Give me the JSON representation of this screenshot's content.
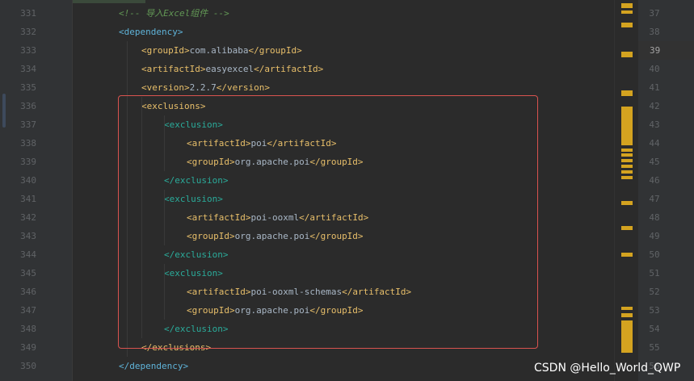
{
  "gutter_left": {
    "line_numbers": [
      "331",
      "332",
      "333",
      "334",
      "335",
      "336",
      "337",
      "338",
      "339",
      "340",
      "341",
      "342",
      "343",
      "344",
      "345",
      "346",
      "347",
      "348",
      "349",
      "350"
    ]
  },
  "code": {
    "comment": "<!-- 导入Excel组件 -->",
    "lines": [
      {
        "open": "<dependency>",
        "text": "",
        "close": ""
      },
      {
        "open": "<groupId>",
        "text": "com.alibaba",
        "close": "</groupId>"
      },
      {
        "open": "<artifactId>",
        "text": "easyexcel",
        "close": "</artifactId>"
      },
      {
        "open": "<version>",
        "text": "2.2.7",
        "close": "</version>"
      },
      {
        "open": "<exclusions>",
        "text": "",
        "close": ""
      },
      {
        "open": "<exclusion>",
        "text": "",
        "close": ""
      },
      {
        "open": "<artifactId>",
        "text": "poi",
        "close": "</artifactId>"
      },
      {
        "open": "<groupId>",
        "text": "org.apache.poi",
        "close": "</groupId>"
      },
      {
        "open": "",
        "text": "",
        "close": "</exclusion>"
      },
      {
        "open": "<exclusion>",
        "text": "",
        "close": ""
      },
      {
        "open": "<artifactId>",
        "text": "poi-ooxml",
        "close": "</artifactId>"
      },
      {
        "open": "<groupId>",
        "text": "org.apache.poi",
        "close": "</groupId>"
      },
      {
        "open": "",
        "text": "",
        "close": "</exclusion>"
      },
      {
        "open": "<exclusion>",
        "text": "",
        "close": ""
      },
      {
        "open": "<artifactId>",
        "text": "poi-ooxml-schemas",
        "close": "</artifactId>"
      },
      {
        "open": "<groupId>",
        "text": "org.apache.poi",
        "close": "</groupId>"
      },
      {
        "open": "",
        "text": "",
        "close": "</exclusion>"
      },
      {
        "open": "",
        "text": "",
        "close": "</exclusions>"
      },
      {
        "open": "",
        "text": "",
        "close": "</dependency>"
      }
    ]
  },
  "gutter_right": {
    "line_numbers": [
      "37",
      "38",
      "39",
      "40",
      "41",
      "42",
      "43",
      "44",
      "45",
      "46",
      "47",
      "48",
      "49",
      "50",
      "51",
      "52",
      "53",
      "54",
      "55",
      "56"
    ],
    "current_line": "39"
  },
  "watermark": "CSDN @Hello_World_QWP",
  "colors": {
    "background": "#2b2b2b",
    "tag": "#e8bf6a",
    "tag_blue": "#5fb3d9",
    "tag_teal": "#2bab9a",
    "text": "#a9b7c6",
    "comment": "#629755",
    "highlight_box": "#d9534f",
    "marker": "#d4a320"
  }
}
